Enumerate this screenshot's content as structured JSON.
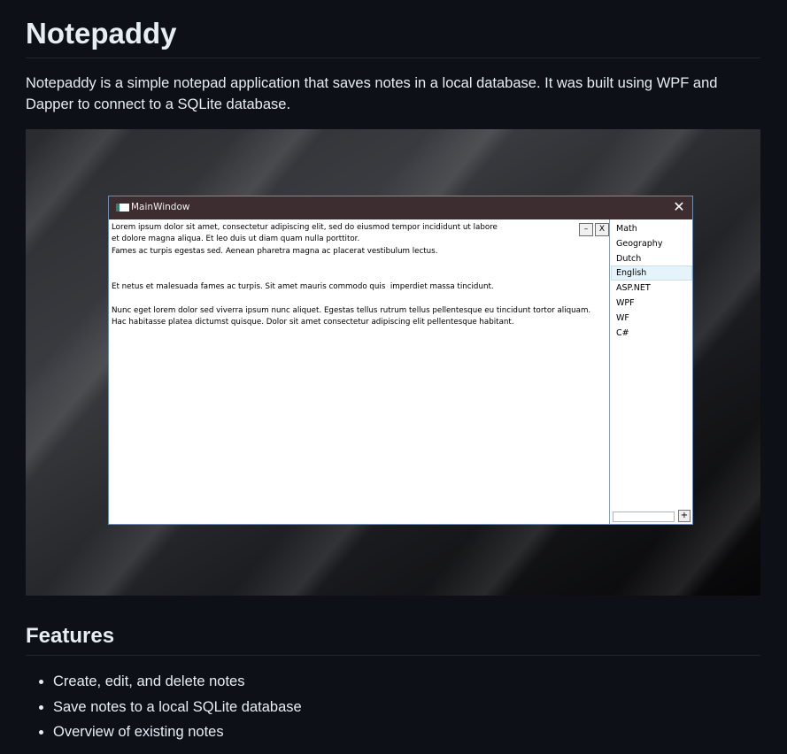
{
  "header": {
    "title": "Notepaddy",
    "intro": "Notepaddy is a simple notepad application that saves notes in a local database. It was built using WPF and Dapper to connect to a SQLite database."
  },
  "screenshot": {
    "window_title": "MainWindow",
    "close_glyph": "✕",
    "minimize_glyph": "–",
    "delete_glyph": "X",
    "add_glyph": "+",
    "editor_text": "Lorem ipsum dolor sit amet, consectetur adipiscing elit, sed do eiusmod tempor incididunt ut labore\net dolore magna aliqua. Et leo duis ut diam quam nulla porttitor.\nFames ac turpis egestas sed. Aenean pharetra magna ac placerat vestibulum lectus.\n\n\nEt netus et malesuada fames ac turpis. Sit amet mauris commodo quis  imperdiet massa tincidunt.\n\nNunc eget lorem dolor sed viverra ipsum nunc aliquet. Egestas tellus rutrum tellus pellentesque eu tincidunt tortor aliquam.\nHac habitasse platea dictumst quisque. Dolor sit amet consectetur adipiscing elit pellentesque habitant.",
    "notes": [
      "Math",
      "Geography",
      "Dutch",
      "English",
      "ASP.NET",
      "WPF",
      "WF",
      "C#"
    ],
    "selected_note": "English"
  },
  "features": {
    "title": "Features",
    "items": [
      "Create, edit, and delete notes",
      "Save notes to a local SQLite database",
      "Overview of existing notes"
    ]
  },
  "colors": {
    "page_bg": "#0d1117",
    "text": "#e6edf3",
    "window_titlebar": "#3d2c30",
    "selection": "#e5f3fb"
  }
}
